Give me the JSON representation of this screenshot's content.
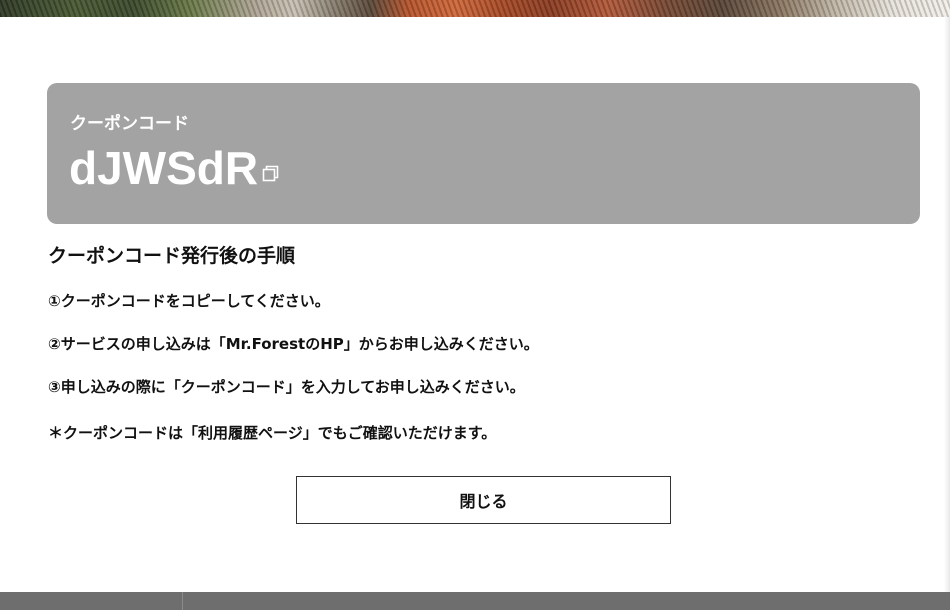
{
  "coupon": {
    "label": "クーポンコード",
    "code": "dJWSdR",
    "copy_icon": "copy-icon"
  },
  "instructions": {
    "heading": "クーポンコード発行後の手順",
    "step1": "①クーポンコードをコピーしてください。",
    "step2": "②サービスの申し込みは「Mr.ForestのHP」からお申し込みください。",
    "step3": "③申し込みの際に「クーポンコード」を入力してお申し込みください。",
    "note": "＊クーポンコードは「利用履歴ページ」でもご確認いただけます。"
  },
  "actions": {
    "close_label": "閉じる"
  },
  "colors": {
    "coupon_box": "#a3a3a3",
    "text": "#111111",
    "button_border": "#333333"
  }
}
